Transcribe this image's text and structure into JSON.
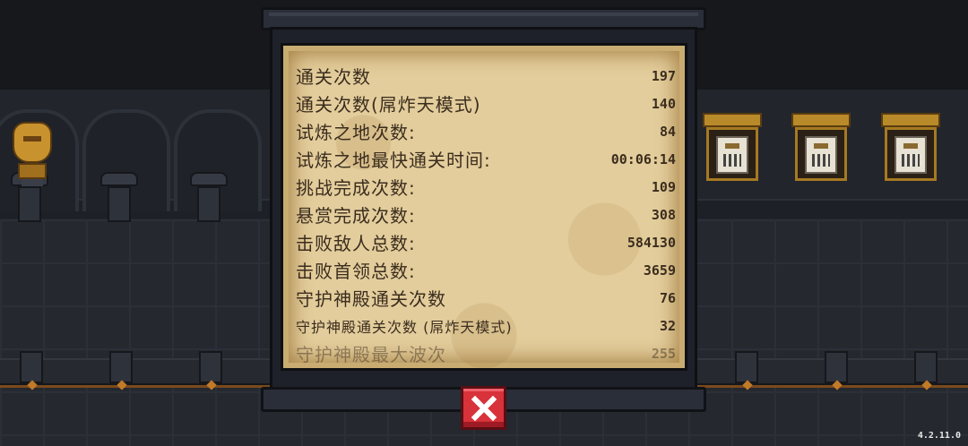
{
  "stats_board": {
    "rows": [
      {
        "label": "通关次数",
        "value": "197"
      },
      {
        "label": "通关次数(屌炸天模式)",
        "value": "140"
      },
      {
        "label": "试炼之地次数:",
        "value": "84"
      },
      {
        "label": "试炼之地最快通关时间:",
        "value": "00:06:14"
      },
      {
        "label": "挑战完成次数:",
        "value": "109"
      },
      {
        "label": "悬赏完成次数:",
        "value": "308"
      },
      {
        "label": "击败敌人总数:",
        "value": "584130"
      },
      {
        "label": "击败首领总数:",
        "value": "3659"
      },
      {
        "label": "守护神殿通关次数",
        "value": "76"
      },
      {
        "label": "守护神殿通关次数 (屌炸天模式)",
        "value": "32"
      },
      {
        "label": "守护神殿最大波次",
        "value": "255"
      }
    ]
  },
  "close_button": {
    "icon": "close-x-icon",
    "color": "#d8323a"
  },
  "version": "4.2.11.0",
  "colors": {
    "parchment": "#e3cd9c",
    "text": "#3b2d1e",
    "panel": "#1e2129"
  }
}
